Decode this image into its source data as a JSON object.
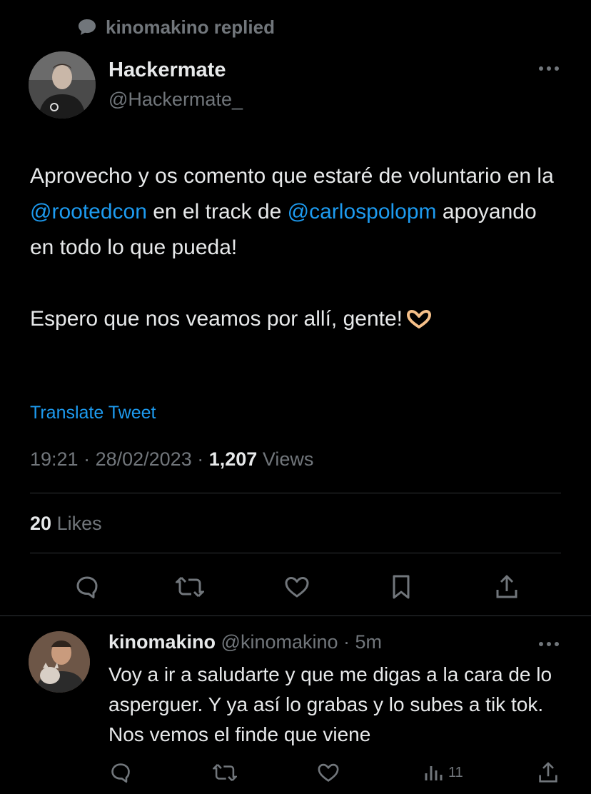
{
  "replied_header": {
    "text": "kinomakino replied",
    "icon": "speech-bubble-icon"
  },
  "tweet": {
    "author_name": "Hackermate",
    "author_handle": "@Hackermate_",
    "body": {
      "l1_a": "Aprovecho y os comento que estaré de voluntario en la ",
      "mention_1": "@rootedcon",
      "l1_b": " en el track de ",
      "mention_2": "@carlospolopm",
      "l1_c": " apoyando en todo lo que pueda!",
      "p2": "Espero que nos veamos por allí, gente!",
      "emoji": "heart-hands-emoji"
    },
    "translate_label": "Translate Tweet",
    "time": "19:21",
    "date": "28/02/2023",
    "views_count": "1,207",
    "views_label": "Views",
    "likes_count": "20",
    "likes_label": "Likes",
    "actions": [
      "reply-icon",
      "retweet-icon",
      "like-icon",
      "bookmark-icon",
      "share-icon"
    ]
  },
  "reply": {
    "name": "kinomakino",
    "handle": "@kinomakino",
    "time": "5m",
    "text": "Voy a ir a saludarte y que me digas a la cara de lo asperguer. Y ya así lo grabas y lo subes a tik tok. Nos vemos el finde que viene",
    "views_count": "11"
  },
  "colors": {
    "background": "#000000",
    "text": "#e7e9ea",
    "muted": "#71767b",
    "link": "#1d9bf0",
    "divider": "#2f3336"
  }
}
